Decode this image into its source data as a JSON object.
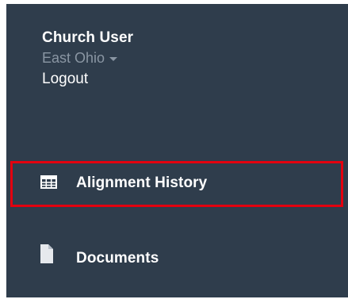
{
  "user": {
    "name": "Church User",
    "organization": "East Ohio",
    "logout_label": "Logout"
  },
  "nav": {
    "items": [
      {
        "label": "Alignment History",
        "icon": "table-icon",
        "highlighted": true
      },
      {
        "label": "Documents",
        "icon": "document-icon",
        "highlighted": false
      }
    ]
  },
  "colors": {
    "sidebar_bg": "#2f3d4c",
    "highlight_border": "#e3000f",
    "muted_text": "#8a96a3"
  }
}
